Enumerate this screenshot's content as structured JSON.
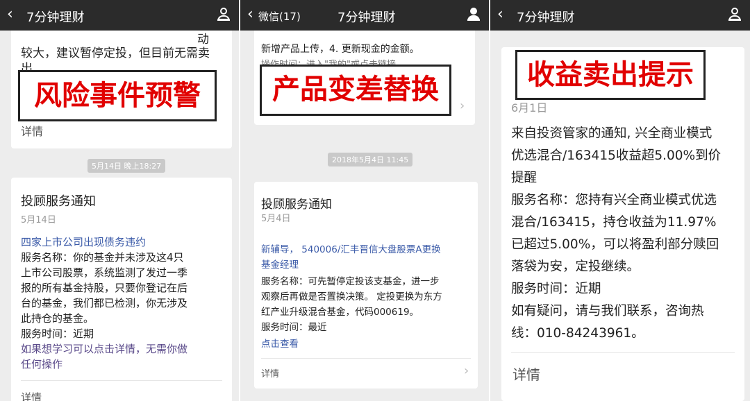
{
  "screen1": {
    "title": "7分钟理财",
    "top_fragment_line1": "动",
    "top_fragment_line2": "较大，建议暂停定投，但目前无需卖",
    "top_fragment_line3": "出",
    "overlay": "风险事件预警",
    "detail1": "详情",
    "timestamp": "5月14日 晚上18:27",
    "card_title": "投顾服务通知",
    "card_date": "5月14日",
    "lines": [
      "四家上市公司出现债务违约",
      "服务名称：你的基金并未涉及这4只",
      "上市公司股票，系统监测了发过一季",
      "报的所有基金持股，只要你登记在后",
      "台的基金，我们都已检测，你无涉及",
      "此持仓的基金。",
      "服务时间：近期",
      "如果想学习可以点击详情，无需你做",
      "任何操作"
    ],
    "detail2": "详情"
  },
  "screen2": {
    "back_label": "微信(17)",
    "title": "7分钟理财",
    "top_fragment_line1": "新增产品上传，4. 更新现金的金额。",
    "top_fragment_line2": "操作时间：进入\"我的\"或点击链接",
    "overlay": "产品变差替换",
    "timestamp": "2018年5月4日 11:45",
    "card_title": "投顾服务通知",
    "card_date": "5月4日",
    "lines": [
      "新辅导， 540006/汇丰晋信大盘股票A更换",
      "基金经理",
      "服务名称：可先暂停定投该支基金，进一步",
      "观察后再做是否置换决策。 定投更换为东方",
      "红产业升级混合基金，代码000619。",
      "服务时间：最近",
      "点击查看"
    ],
    "detail": "详情"
  },
  "screen3": {
    "title": "7分钟理财",
    "overlay": "收益卖出提示",
    "card_date": "6月1日",
    "lines": [
      "来自投资管家的通知, 兴全商业模式",
      "优选混合/163415收益超5.00%到价",
      "提醒",
      "服务名称：您持有兴全商业模式优选",
      "混合/163415，持仓收益为11.97%",
      "已超过5.00%，可以将盈利部分赎回",
      "落袋为安，定投继续。",
      "服务时间：近期",
      "如有疑问，请与我们联系，咨询热",
      "线：010-84243961。"
    ],
    "detail": "详情"
  },
  "icons": {
    "back": "chevron-left-icon",
    "user": "user-icon",
    "chevron": "chevron-right-icon"
  },
  "colors": {
    "titlebar": "#2b2b2b",
    "overlay_text": "#e10000",
    "link": "#3a5aa8",
    "background": "#ededed"
  }
}
